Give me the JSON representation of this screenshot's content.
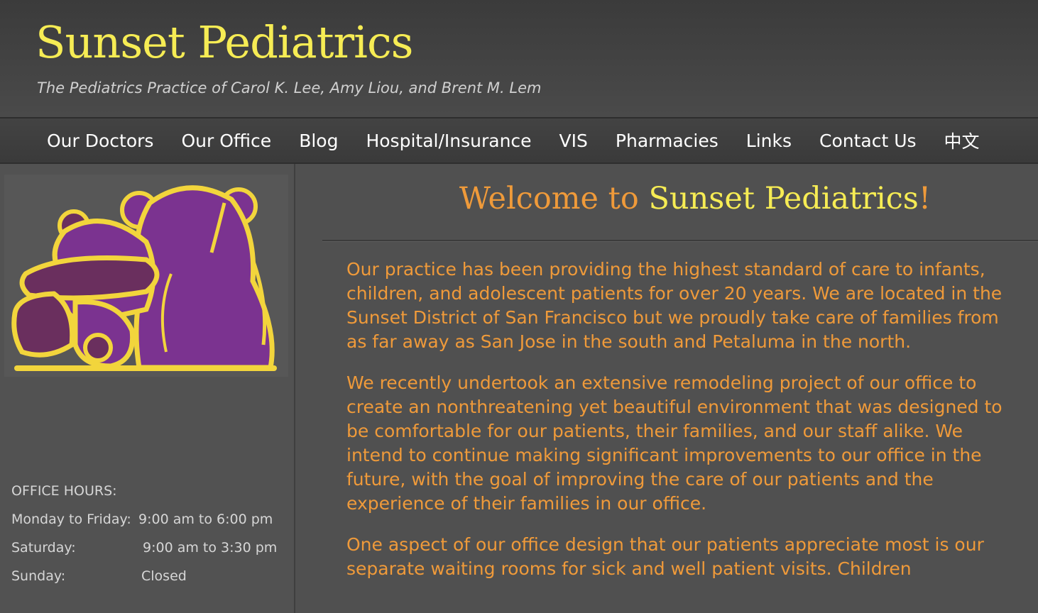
{
  "header": {
    "title": "Sunset Pediatrics",
    "tagline": "The Pediatrics Practice of Carol K. Lee, Amy Liou, and Brent M. Lem"
  },
  "nav": {
    "items": [
      "Our Doctors",
      "Our Office",
      "Blog",
      "Hospital/Insurance",
      "VIS",
      "Pharmacies",
      "Links",
      "Contact Us",
      "中文"
    ]
  },
  "sidebar": {
    "logo_icon": "teddy-bears-logo-icon",
    "hours_title": "OFFICE HOURS:",
    "hours": [
      {
        "day": "Monday to Friday:",
        "time": "9:00 am to 6:00 pm"
      },
      {
        "day": "Saturday:",
        "time": "9:00 am to 3:30 pm"
      },
      {
        "day": "Sunday:",
        "time": "Closed"
      }
    ]
  },
  "main": {
    "welcome_prefix": "Welcome to ",
    "welcome_name": "Sunset Pediatrics",
    "welcome_suffix": "!",
    "paragraphs": [
      "Our practice has been providing the highest standard of care to infants, children, and adolescent patients for over 20 years.  We are located in the Sunset District of San Francisco but we proudly take care of families from as far away as San Jose in the south and Petaluma in the north.",
      "We recently undertook an extensive remodeling project of our office to create an nonthreatening yet beautiful environment that was designed to be comfortable for our patients, their families, and our staff alike. We intend to continue making significant improvements to our office in the future, with the goal of improving the care of our patients and the experience of their families in our office.",
      "One aspect of our office design that our patients appreciate most is our separate waiting rooms for sick and well patient visits.  Children"
    ]
  },
  "colors": {
    "title_yellow": "#f6ec54",
    "text_orange": "#ef9a3a",
    "bear_purple": "#7b3390",
    "bear_dark": "#6a2f5e",
    "outline_yellow": "#f2d53c"
  }
}
